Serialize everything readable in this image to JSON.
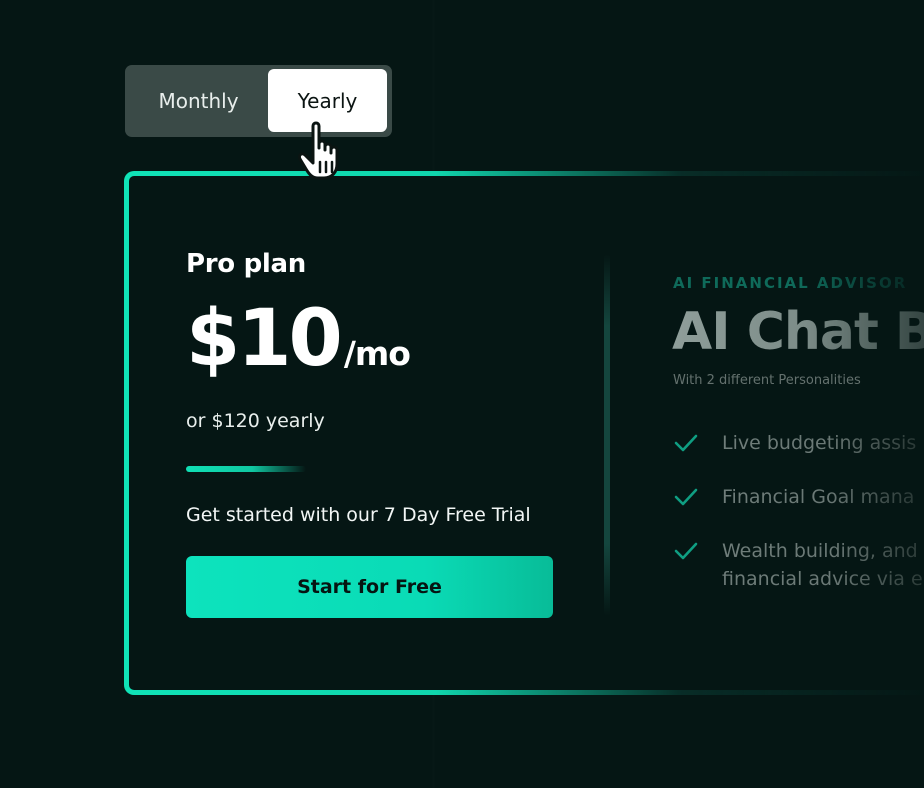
{
  "billing_toggle": {
    "monthly_label": "Monthly",
    "yearly_label": "Yearly",
    "selected": "Yearly"
  },
  "plan": {
    "name": "Pro plan",
    "price": "$10",
    "price_unit": "/mo",
    "yearly_note": "or $120 yearly",
    "trial_text": "Get started with our 7 Day Free Trial",
    "cta_label": "Start for Free"
  },
  "product": {
    "eyebrow": "AI FINANCIAL ADVISOR",
    "title": "AI Chat Bo",
    "subtitle": "With 2 different Personalities",
    "features": [
      {
        "line1": "Live budgeting assis",
        "line2": ""
      },
      {
        "line1": "Financial Goal mana",
        "line2": ""
      },
      {
        "line1": "Wealth building, and",
        "line2": "financial advice via e"
      }
    ]
  },
  "colors": {
    "background": "#051614",
    "accent": "#10e3b7",
    "toggle_track": "#3a4a47",
    "check": "#0f9e82"
  },
  "icons": {
    "cursor": "hand-pointer-icon",
    "feature_check": "check-icon"
  }
}
